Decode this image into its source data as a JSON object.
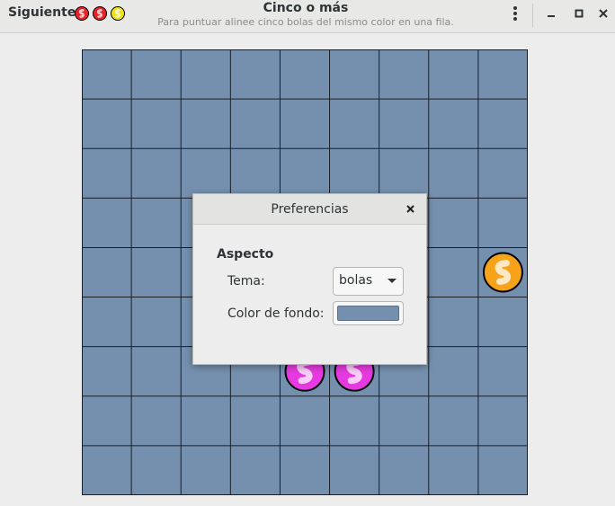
{
  "header": {
    "next_label": "Siguiente:",
    "next_balls": [
      "red",
      "red",
      "yellow"
    ],
    "title": "Cinco o más",
    "subtitle": "Para puntuar alinee cinco bolas del mismo color en una fila.",
    "menu_icon": "kebab-menu-icon",
    "minimize_icon": "minimize-icon",
    "maximize_icon": "maximize-icon",
    "close_icon": "close-icon"
  },
  "board": {
    "columns": 9,
    "rows": 9,
    "background_color": "#7590ae",
    "balls": [
      {
        "row": 4,
        "col": 8,
        "color": "orange"
      },
      {
        "row": 6,
        "col": 4,
        "color": "magenta"
      },
      {
        "row": 6,
        "col": 5,
        "color": "magenta"
      }
    ]
  },
  "dialog": {
    "title": "Preferencias",
    "section": "Aspecto",
    "theme_label": "Tema:",
    "theme_value": "bolas",
    "bg_color_label": "Color de fondo:",
    "bg_color_value": "#7590ae"
  },
  "colors": {
    "red": "#e8232a",
    "yellow": "#f2e21a",
    "orange": "#f7a21b",
    "magenta": "#e63ae0"
  }
}
